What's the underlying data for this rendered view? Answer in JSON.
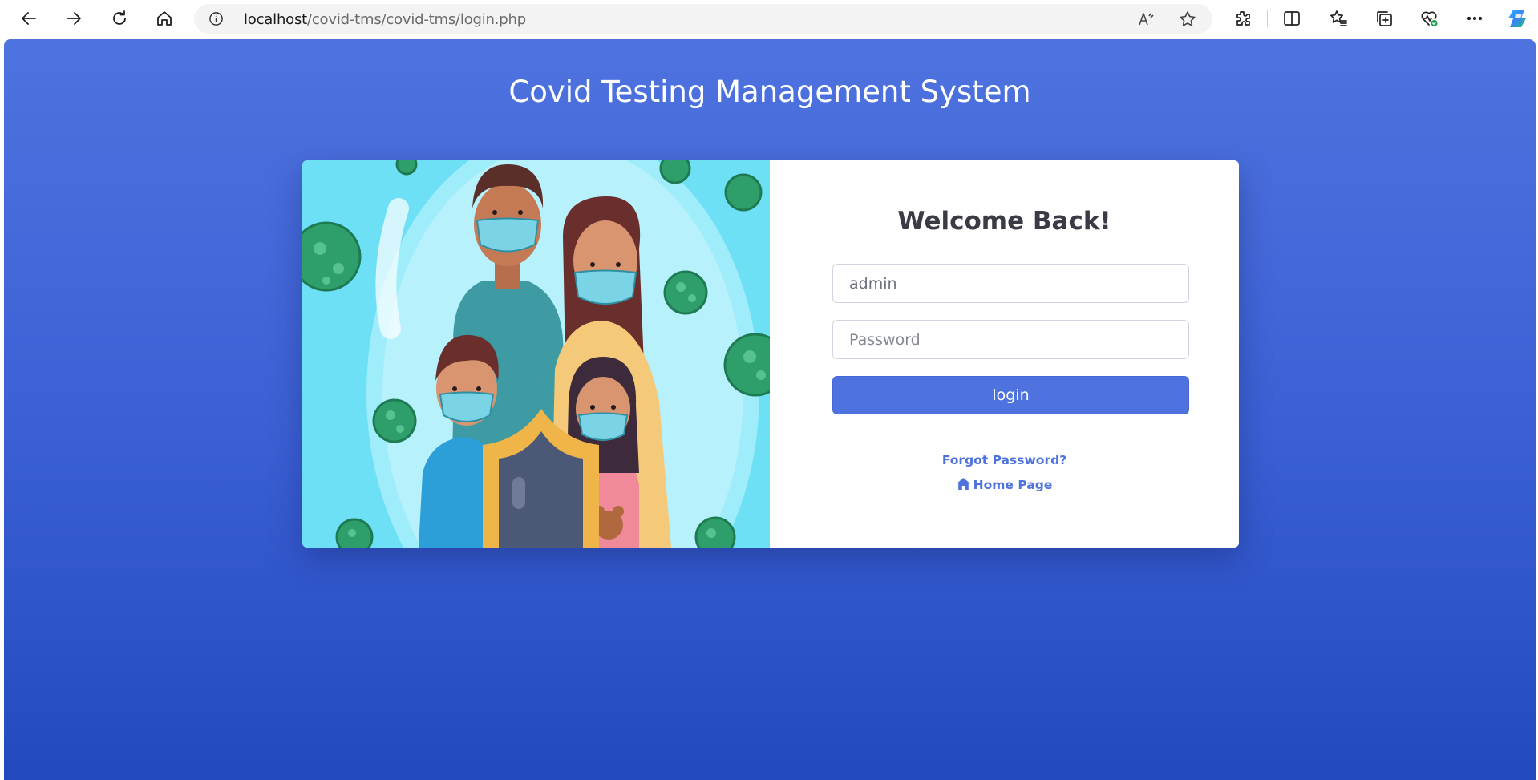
{
  "browser": {
    "url_host": "localhost",
    "url_path": "/covid-tms/covid-tms/login.php"
  },
  "page": {
    "site_title": "Covid Testing Management System",
    "welcome_heading": "Welcome Back!",
    "username_value": "admin",
    "password_placeholder": "Password",
    "login_label": "login",
    "forgot_password_label": "Forgot Password?",
    "home_page_label": "Home Page"
  },
  "colors": {
    "primary": "#4e73df",
    "gradient_bottom": "#224abe",
    "illustration_bg": "#6ee0f5"
  },
  "icons": [
    "back-icon",
    "forward-icon",
    "refresh-icon",
    "home-icon",
    "info-icon",
    "read-aloud-icon",
    "favorite-star-icon",
    "extensions-icon",
    "split-screen-icon",
    "favorites-icon",
    "collections-icon",
    "browser-essentials-icon",
    "more-icon",
    "copilot-icon"
  ]
}
